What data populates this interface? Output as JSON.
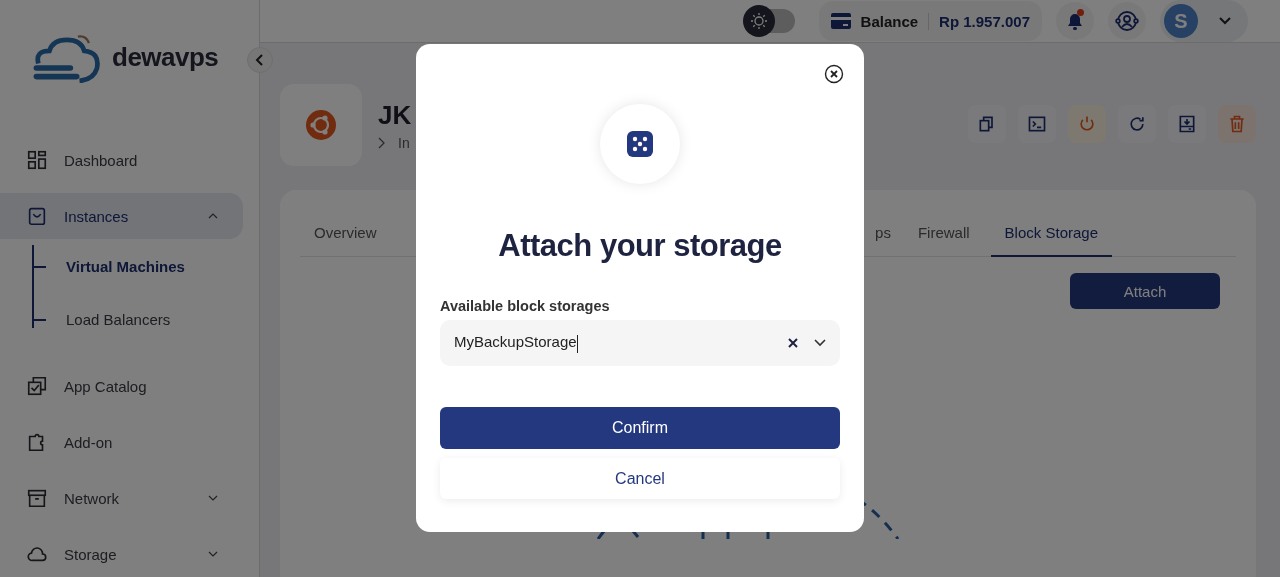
{
  "brand": {
    "name": "dewavps"
  },
  "sidebar": {
    "items": [
      {
        "label": "Dashboard",
        "kind": "link",
        "selected": false
      },
      {
        "label": "Instances",
        "kind": "group",
        "selected": true,
        "expanded": true,
        "children": [
          {
            "label": "Virtual Machines",
            "selected": true
          },
          {
            "label": "Load Balancers",
            "selected": false
          }
        ]
      },
      {
        "label": "App Catalog",
        "kind": "link",
        "selected": false
      },
      {
        "label": "Add-on",
        "kind": "link",
        "selected": false
      },
      {
        "label": "Network",
        "kind": "group",
        "selected": false,
        "expanded": false
      },
      {
        "label": "Storage",
        "kind": "group",
        "selected": false,
        "expanded": false
      }
    ]
  },
  "header": {
    "theme_toggle": {
      "on": false
    },
    "balance": {
      "label": "Balance",
      "value": "Rp 1.957.007"
    },
    "notifications": {
      "unread": true
    },
    "avatar": {
      "initial": "S"
    }
  },
  "instance": {
    "name": "JK",
    "breadcrumb": "In",
    "actions": [
      {
        "kind": "default"
      },
      {
        "kind": "default"
      },
      {
        "kind": "warning"
      },
      {
        "kind": "default"
      },
      {
        "kind": "default"
      },
      {
        "kind": "danger"
      }
    ]
  },
  "tabs": [
    {
      "label": "Overview",
      "selected": false
    },
    {
      "label": "ps",
      "selected": false
    },
    {
      "label": "Firewall",
      "selected": false
    },
    {
      "label": "Block Storage",
      "selected": true
    }
  ],
  "attach_button": "Attach",
  "modal": {
    "title": "Attach your storage",
    "field_label": "Available block storages",
    "value": "MyBackupStorage",
    "confirm": "Confirm",
    "cancel": "Cancel"
  }
}
